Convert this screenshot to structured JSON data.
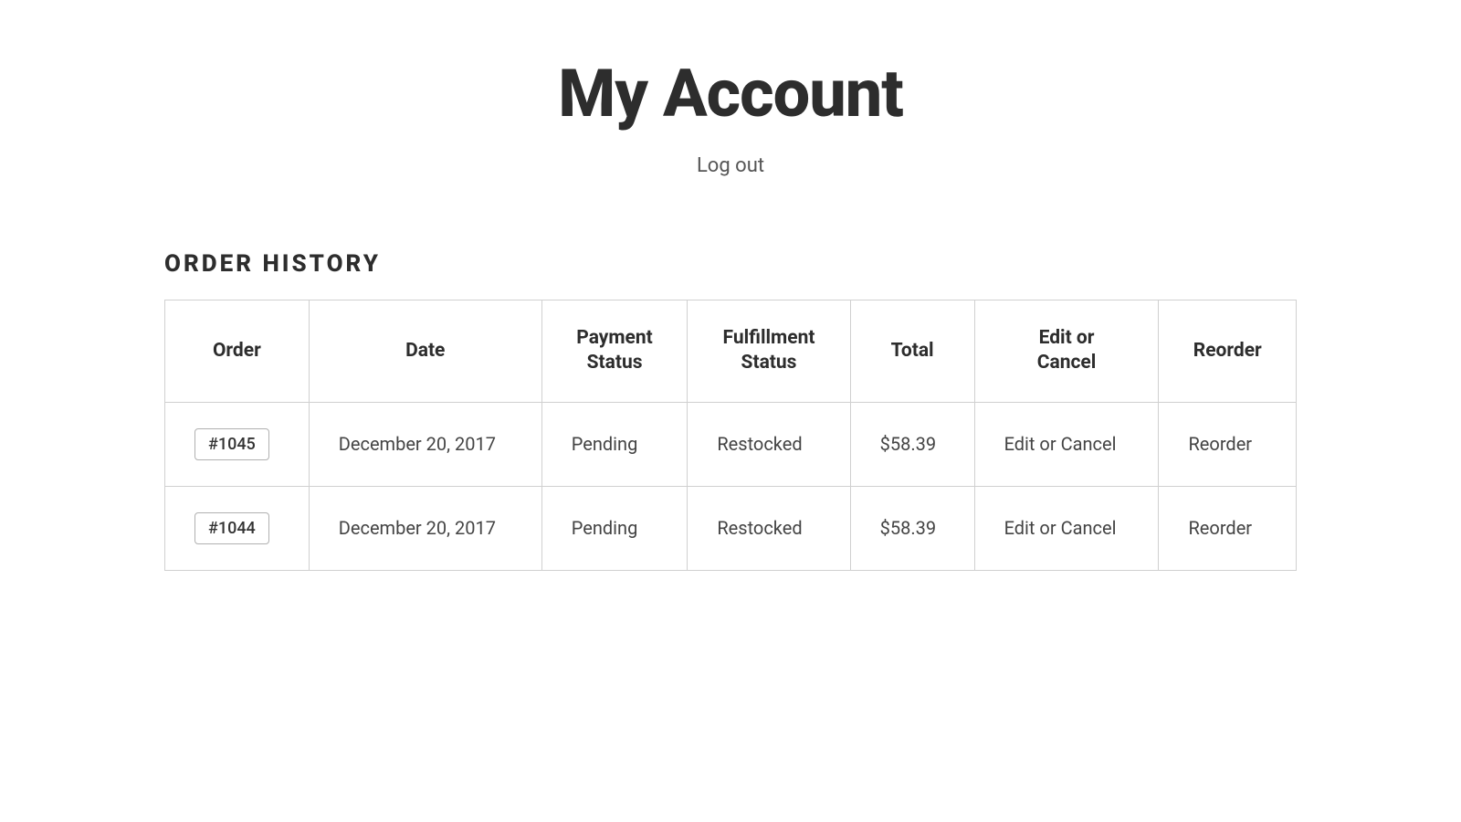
{
  "page": {
    "title": "My Account",
    "logout_label": "Log out"
  },
  "order_history": {
    "section_title": "ORDER HISTORY",
    "columns": [
      {
        "key": "order",
        "label": "Order"
      },
      {
        "key": "date",
        "label": "Date"
      },
      {
        "key": "payment_status",
        "label": "Payment Status"
      },
      {
        "key": "fulfillment_status",
        "label": "Fulfillment Status"
      },
      {
        "key": "total",
        "label": "Total"
      },
      {
        "key": "edit_cancel",
        "label": "Edit or Cancel"
      },
      {
        "key": "reorder",
        "label": "Reorder"
      }
    ],
    "rows": [
      {
        "order_id": "#1045",
        "date": "December 20, 2017",
        "payment_status": "Pending",
        "fulfillment_status": "Restocked",
        "total": "$58.39",
        "edit_cancel": "Edit or Cancel",
        "reorder": "Reorder"
      },
      {
        "order_id": "#1044",
        "date": "December 20, 2017",
        "payment_status": "Pending",
        "fulfillment_status": "Restocked",
        "total": "$58.39",
        "edit_cancel": "Edit or Cancel",
        "reorder": "Reorder"
      }
    ]
  }
}
